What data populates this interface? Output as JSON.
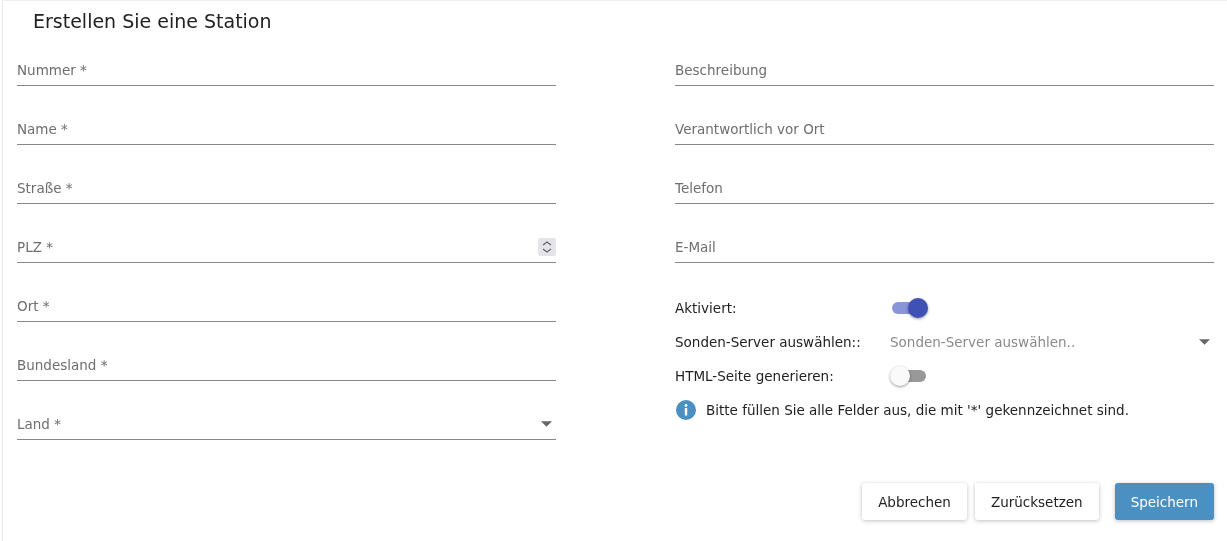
{
  "title": "Erstellen Sie eine Station",
  "left_fields": [
    {
      "kind": "text",
      "placeholder": "Nummer *"
    },
    {
      "kind": "text",
      "placeholder": "Name *"
    },
    {
      "kind": "text",
      "placeholder": "Straße *"
    },
    {
      "kind": "number",
      "placeholder": "PLZ *"
    },
    {
      "kind": "text",
      "placeholder": "Ort *"
    },
    {
      "kind": "text",
      "placeholder": "Bundesland *"
    },
    {
      "kind": "select",
      "placeholder": "Land *"
    }
  ],
  "right_fields": [
    {
      "placeholder": "Beschreibung"
    },
    {
      "placeholder": "Verantwortlich vor Ort"
    },
    {
      "placeholder": "Telefon"
    },
    {
      "placeholder": "E-Mail"
    }
  ],
  "settings": [
    {
      "kind": "toggle",
      "label": "Aktiviert:",
      "on": true
    },
    {
      "kind": "select",
      "label": "Sonden-Server auswählen::",
      "placeholder": "Sonden-Server auswählen.."
    },
    {
      "kind": "toggle",
      "label": "HTML-Seite generieren:",
      "on": false
    }
  ],
  "note": "Bitte füllen Sie alle Felder aus, die mit '*' gekennzeichnet sind.",
  "buttons": [
    {
      "kind": "default",
      "label": "Abbrechen"
    },
    {
      "kind": "default",
      "label": "Zurücksetzen"
    },
    {
      "kind": "primary",
      "label": "Speichern"
    }
  ]
}
